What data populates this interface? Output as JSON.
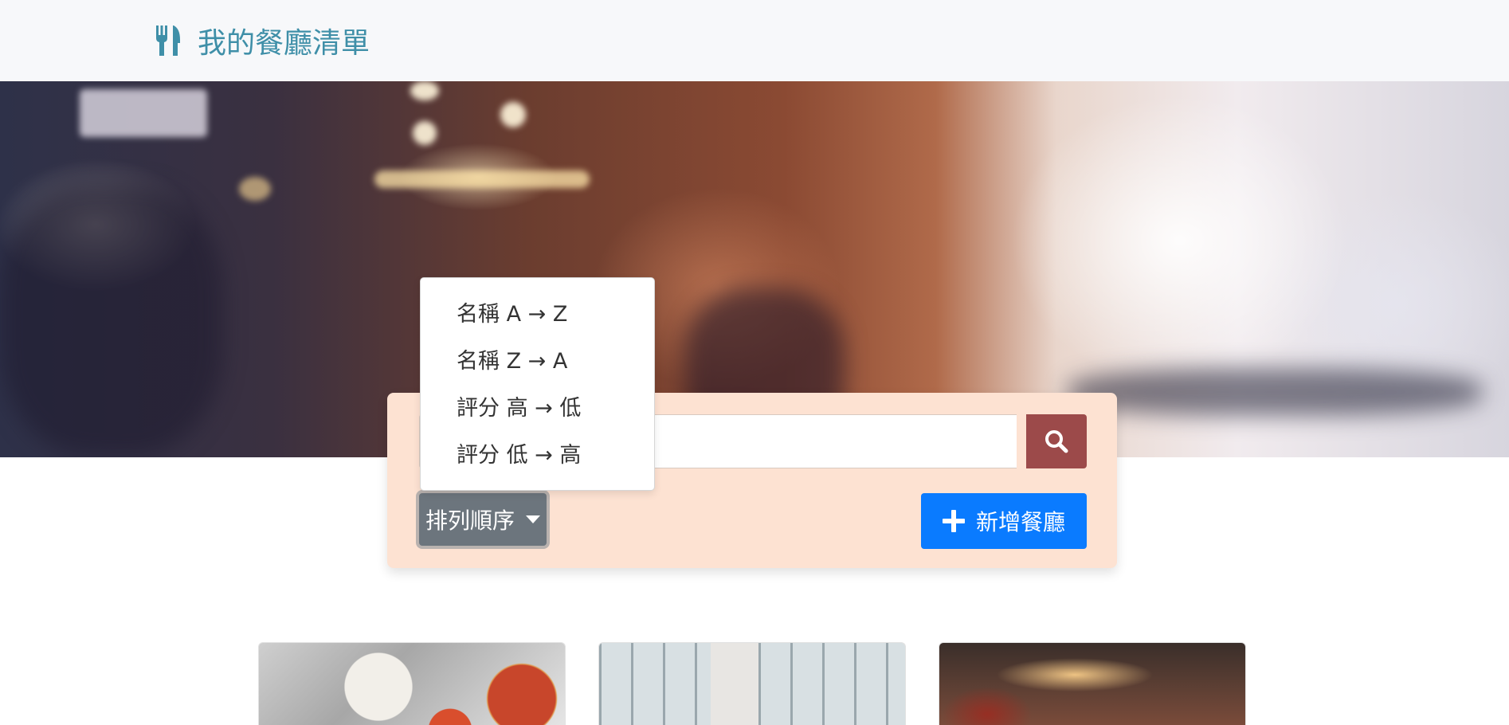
{
  "navbar": {
    "icon": "utensils-icon",
    "title": "我的餐廳清單",
    "color": "#3f8fa8"
  },
  "search": {
    "value": "",
    "icon": "search-icon",
    "button_color": "#9c4a4a"
  },
  "sort": {
    "label": "排列順序",
    "icon": "caret-down-icon",
    "options": [
      "名稱 A → Z",
      "名稱 Z → A",
      "評分 高 → 低",
      "評分 低 → 高"
    ]
  },
  "add_button": {
    "label": "新增餐廳",
    "icon": "plus-icon",
    "color": "#0a7bff"
  },
  "panel_color": "#fde2d2"
}
